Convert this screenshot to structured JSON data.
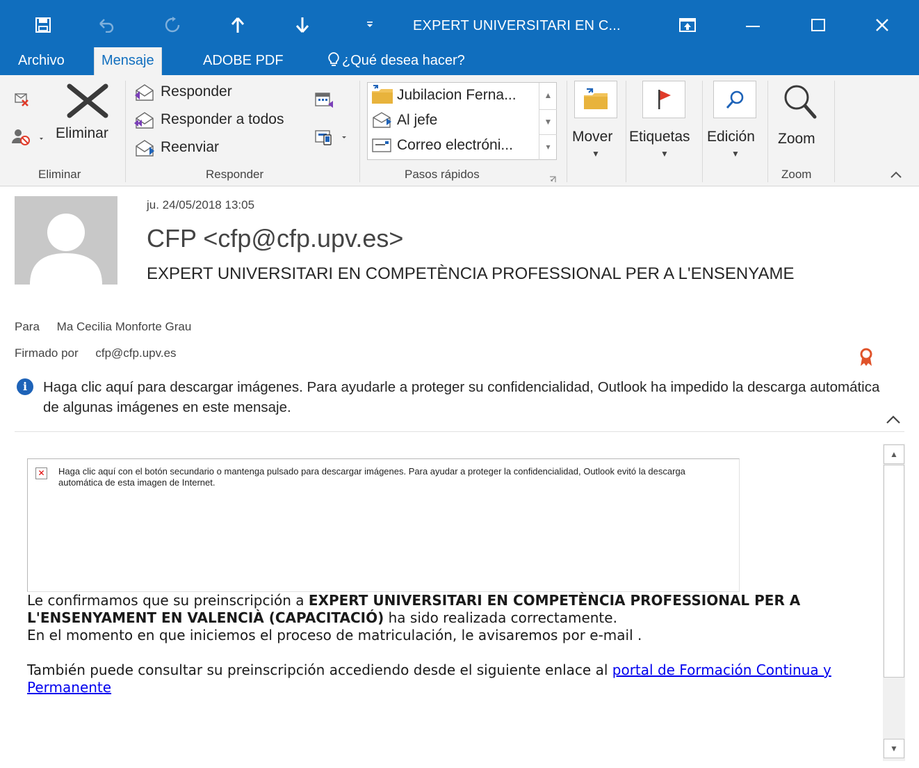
{
  "window": {
    "title": "EXPERT UNIVERSITARI EN C...",
    "accent_color": "#106ebe",
    "quick_access": [
      "save-icon",
      "undo-icon",
      "redo-icon",
      "previous-item-icon",
      "next-item-icon",
      "customize-icon"
    ],
    "controls": [
      "ribbon-display-options-icon",
      "minimize-icon",
      "maximize-icon",
      "close-icon"
    ]
  },
  "tabs": {
    "archivo": "Archivo",
    "mensaje": "Mensaje",
    "adobe_pdf": "ADOBE PDF",
    "tell_me": "¿Qué desea hacer?"
  },
  "ribbon": {
    "eliminar_group": {
      "delete_label": "Eliminar",
      "group_label": "Eliminar"
    },
    "responder_group": {
      "reply": "Responder",
      "reply_all": "Responder a todos",
      "forward": "Reenviar",
      "group_label": "Responder"
    },
    "quick_steps": {
      "items": [
        "Jubilacion Ferna...",
        "Al jefe",
        "Correo electróni..."
      ],
      "group_label": "Pasos rápidos"
    },
    "move_label": "Mover",
    "tags_label": "Etiquetas",
    "editing_label": "Edición",
    "zoom": {
      "button_label": "Zoom",
      "group_label": "Zoom"
    }
  },
  "message": {
    "date": "ju. 24/05/2018 13:05",
    "sender": "CFP <cfp@cfp.upv.es>",
    "subject": "EXPERT UNIVERSITARI EN COMPETÈNCIA PROFESSIONAL PER A L'ENSENYAME",
    "to_label": "Para",
    "to_value": "Ma Cecilia Monforte Grau",
    "signed_label": "Firmado por",
    "signed_value": "cfp@cfp.upv.es",
    "info_bar": "Haga clic aquí para descargar imágenes. Para ayudarle a proteger su confidencialidad, Outlook ha impedido la descarga automática de algunas imágenes en este mensaje."
  },
  "body": {
    "image_placeholder": "Haga clic aquí con el botón secundario o mantenga pulsado para descargar imágenes. Para ayudar a proteger la confidencialidad, Outlook evitó la descarga automática de esta imagen de Internet.",
    "p1_prefix": "Le confirmamos que su preinscripción a ",
    "p1_bold": "EXPERT UNIVERSITARI EN COMPETÈNCIA PROFESSIONAL PER A L'ENSENYAMENT EN VALENCIÀ (CAPACITACIÓ)",
    "p1_suffix": " ha sido realizada correctamente.",
    "p2": "En el momento en que iniciemos el proceso de matriculación, le avisaremos por e-mail .",
    "p3_prefix": "También puede consultar su preinscripción accediendo desde el siguiente enlace al ",
    "p3_link": "portal de Formación Continua y Permanente"
  }
}
